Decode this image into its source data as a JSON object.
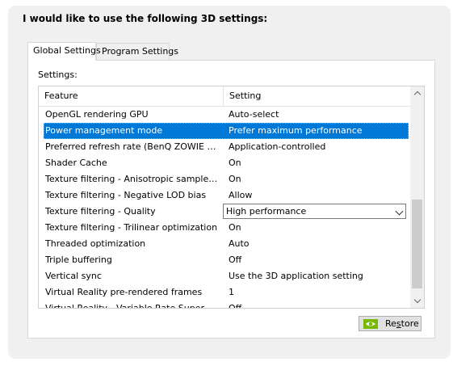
{
  "heading": "I would like to use the following 3D settings:",
  "tabs": [
    {
      "label": "Global Settings",
      "active": true
    },
    {
      "label": "Program Settings",
      "active": false
    }
  ],
  "settings_label": "Settings:",
  "columns": {
    "feature": "Feature",
    "setting": "Setting"
  },
  "rows": [
    {
      "feature": "OpenGL rendering GPU",
      "setting": "Auto-select"
    },
    {
      "feature": "Power management mode",
      "setting": "Prefer maximum performance",
      "selected": true
    },
    {
      "feature": "Preferred refresh rate (BenQ ZOWIE XL L...",
      "setting": "Application-controlled"
    },
    {
      "feature": "Shader Cache",
      "setting": "On"
    },
    {
      "feature": "Texture filtering - Anisotropic sample opti...",
      "setting": "On"
    },
    {
      "feature": "Texture filtering - Negative LOD bias",
      "setting": "Allow"
    },
    {
      "feature": "Texture filtering - Quality",
      "setting": "High performance",
      "dropdown": true
    },
    {
      "feature": "Texture filtering - Trilinear optimization",
      "setting": "On"
    },
    {
      "feature": "Threaded optimization",
      "setting": "Auto"
    },
    {
      "feature": "Triple buffering",
      "setting": "Off"
    },
    {
      "feature": "Vertical sync",
      "setting": "Use the 3D application setting"
    },
    {
      "feature": "Virtual Reality pre-rendered frames",
      "setting": "1"
    },
    {
      "feature": "Virtual Reality - Variable Rate Super Sam...",
      "setting": "Off"
    }
  ],
  "restore_button": {
    "prefix": "Re",
    "accel": "s",
    "suffix": "tore"
  },
  "colors": {
    "selection": "#0078d7",
    "logo_green": "#76b900"
  },
  "icons": {
    "restore": "nvidia-logo-icon",
    "scroll_up": "chevron-up-icon",
    "scroll_down": "chevron-down-icon",
    "dropdown": "chevron-down-icon"
  }
}
